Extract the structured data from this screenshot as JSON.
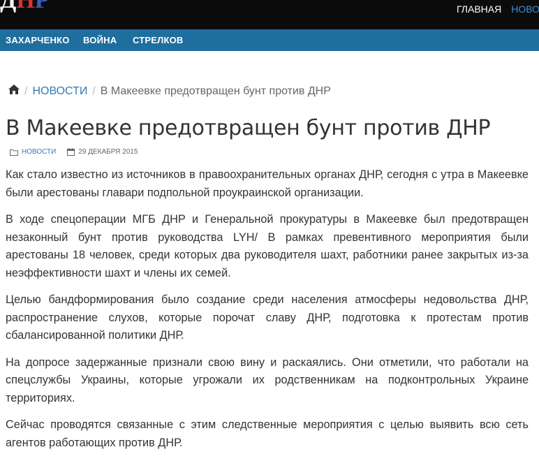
{
  "header": {
    "logo": {
      "part1": "Д",
      "part2": "Н",
      "part3": "Р"
    },
    "nav": [
      {
        "label": "ГЛАВНАЯ"
      },
      {
        "label": "НОВОСТИ"
      }
    ]
  },
  "subnav": {
    "items": [
      {
        "label": "ЗАХАРЧЕНКО"
      },
      {
        "label": "ВОЙНА"
      },
      {
        "label": "СТРЕЛКОВ"
      }
    ]
  },
  "breadcrumb": {
    "home_icon": "home-icon",
    "section": "НОВОСТИ",
    "current": "В Макеевке предотвращен бунт против ДНР"
  },
  "article": {
    "title": "В Макеевке предотвращен бунт против ДНР",
    "category": "НОВОСТИ",
    "date": "29 ДЕКАБРЯ 2015",
    "paragraphs": [
      "Как стало известно из источников в правоохранительных органах ДНР, сегодня с утра в Макеевке были арестованы главари подпольной проукраинской организации.",
      "В ходе спецоперации МГБ ДНР и Генеральной прокуратуры в Макеевке был предотвращен незаконный бунт против руководства LYH/ В рамках превентивного мероприятия были арестованы 18 человек, среди которых два руководителя шахт, работники ранее закрытых из-за неэффективности шахт и члены их семей.",
      "Целью бандформирования было создание среди населения атмосферы недовольства ДНР, распространение слухов, которые порочат славу ДНР, подготовка к протестам против сбалансированной политики ДНР.",
      "На допросе задержанные признали свою вину и раскаялись. Они отметили, что работали на спецслужбы Украины, которые угрожали их родственникам на подконтрольных Украине территориях.",
      "Сейчас проводятся связанные с этим следственные мероприятия с целью выявить всю сеть агентов работающих против ДНР."
    ]
  },
  "colors": {
    "topbar": "#0b0b0b",
    "subnav": "#1e6e9e",
    "link": "#337ab7",
    "active_nav": "#3d8fd6"
  }
}
